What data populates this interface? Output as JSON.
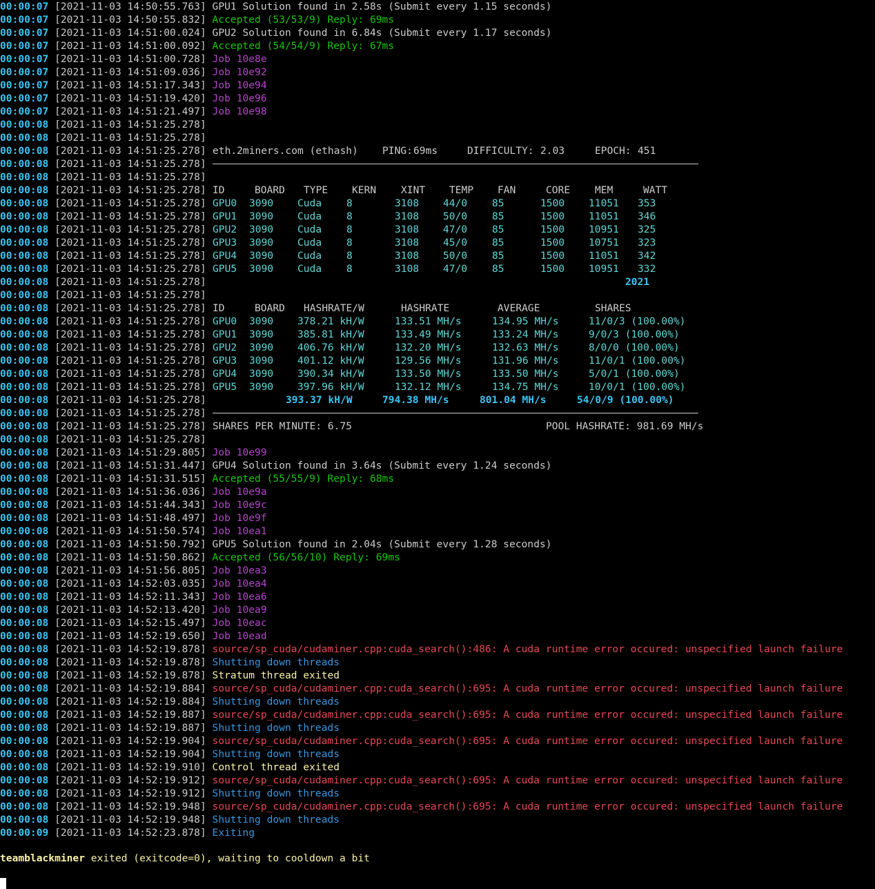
{
  "colors": {
    "background": "#000000",
    "time": "#3bc4f2",
    "default": "#cccccc",
    "accepted": "#16c60c",
    "job": "#b148c6",
    "error": "#e74856",
    "shutdown": "#3a96dd",
    "exited": "#f9f1a5",
    "table_values": "#61d6d6"
  },
  "log_pre": [
    {
      "time": "00:00:07",
      "ts": "[2021-11-03 14:50:55.763]",
      "msg": "GPU1 Solution found in 2.58s (Submit every 1.15 seconds)",
      "color": "white"
    },
    {
      "time": "00:00:07",
      "ts": "[2021-11-03 14:50:55.832]",
      "msg": "Accepted (53/53/9) Reply: 69ms",
      "color": "green"
    },
    {
      "time": "00:00:07",
      "ts": "[2021-11-03 14:51:00.024]",
      "msg": "GPU2 Solution found in 6.84s (Submit every 1.17 seconds)",
      "color": "white"
    },
    {
      "time": "00:00:07",
      "ts": "[2021-11-03 14:51:00.092]",
      "msg": "Accepted (54/54/9) Reply: 67ms",
      "color": "green"
    },
    {
      "time": "00:00:07",
      "ts": "[2021-11-03 14:51:00.728]",
      "msg": "Job 10e8e",
      "color": "magenta"
    },
    {
      "time": "00:00:07",
      "ts": "[2021-11-03 14:51:09.036]",
      "msg": "Job 10e92",
      "color": "magenta"
    },
    {
      "time": "00:00:07",
      "ts": "[2021-11-03 14:51:17.343]",
      "msg": "Job 10e94",
      "color": "magenta"
    },
    {
      "time": "00:00:07",
      "ts": "[2021-11-03 14:51:19.420]",
      "msg": "Job 10e96",
      "color": "magenta"
    },
    {
      "time": "00:00:07",
      "ts": "[2021-11-03 14:51:21.497]",
      "msg": "Job 10e98",
      "color": "magenta"
    },
    {
      "time": "00:00:08",
      "ts": "[2021-11-03 14:51:25.278]",
      "msg": "",
      "color": "white"
    },
    {
      "time": "00:00:08",
      "ts": "[2021-11-03 14:51:25.278]",
      "msg": "",
      "color": "white"
    }
  ],
  "pool": {
    "time": "00:00:08",
    "ts": "[2021-11-03 14:51:25.278]",
    "name": "eth.2miners.com (ethash)",
    "ping_label": "PING:",
    "ping": "69ms",
    "difficulty_label": "DIFFICULTY:",
    "difficulty": "2.03",
    "epoch_label": "EPOCH:",
    "epoch": "451"
  },
  "gap1": [
    {
      "time": "00:00:08",
      "ts": "[2021-11-03 14:51:25.278]"
    },
    {
      "time": "00:00:08",
      "ts": "[2021-11-03 14:51:25.278]"
    }
  ],
  "table1": {
    "time": "00:00:08",
    "ts": "[2021-11-03 14:51:25.278]",
    "headers": [
      "ID",
      "BOARD",
      "TYPE",
      "KERN",
      "XINT",
      "TEMP",
      "FAN",
      "CORE",
      "MEM",
      "WATT"
    ],
    "rows": [
      [
        "GPU0",
        "3090",
        "Cuda",
        "8",
        "3108",
        "44/0",
        "85",
        "1500",
        "11051",
        "353"
      ],
      [
        "GPU1",
        "3090",
        "Cuda",
        "8",
        "3108",
        "50/0",
        "85",
        "1500",
        "11051",
        "346"
      ],
      [
        "GPU2",
        "3090",
        "Cuda",
        "8",
        "3108",
        "47/0",
        "85",
        "1500",
        "10951",
        "325"
      ],
      [
        "GPU3",
        "3090",
        "Cuda",
        "8",
        "3108",
        "45/0",
        "85",
        "1500",
        "10751",
        "323"
      ],
      [
        "GPU4",
        "3090",
        "Cuda",
        "8",
        "3108",
        "50/0",
        "85",
        "1500",
        "11051",
        "342"
      ],
      [
        "GPU5",
        "3090",
        "Cuda",
        "8",
        "3108",
        "47/0",
        "85",
        "1500",
        "10951",
        "332"
      ]
    ],
    "total_watt": "2021"
  },
  "gap2": [
    {
      "time": "00:00:08",
      "ts": "[2021-11-03 14:51:25.278]"
    }
  ],
  "table2": {
    "time": "00:00:08",
    "ts": "[2021-11-03 14:51:25.278]",
    "headers": [
      "ID",
      "BOARD",
      "HASHRATE/W",
      "HASHRATE",
      "AVERAGE",
      "SHARES"
    ],
    "rows": [
      [
        "GPU0",
        "3090",
        "378.21 kH/W",
        "133.51 MH/s",
        "134.95 MH/s",
        "11/0/3 (100.00%)"
      ],
      [
        "GPU1",
        "3090",
        "385.81 kH/W",
        "133.49 MH/s",
        "133.24 MH/s",
        "9/0/3 (100.00%)"
      ],
      [
        "GPU2",
        "3090",
        "406.76 kH/W",
        "132.20 MH/s",
        "132.63 MH/s",
        "8/0/0 (100.00%)"
      ],
      [
        "GPU3",
        "3090",
        "401.12 kH/W",
        "129.56 MH/s",
        "131.96 MH/s",
        "11/0/1 (100.00%)"
      ],
      [
        "GPU4",
        "3090",
        "390.34 kH/W",
        "133.50 MH/s",
        "133.50 MH/s",
        "5/0/1 (100.00%)"
      ],
      [
        "GPU5",
        "3090",
        "397.96 kH/W",
        "132.12 MH/s",
        "134.75 MH/s",
        "10/0/1 (100.00%)"
      ]
    ],
    "totals": [
      "393.37 kH/W",
      "794.38 MH/s",
      "801.04 MH/s",
      "54/0/9 (100.00%)"
    ]
  },
  "gap3": [
    {
      "time": "00:00:08",
      "ts": "[2021-11-03 14:51:25.278]"
    }
  ],
  "summary": {
    "time": "00:00:08",
    "ts": "[2021-11-03 14:51:25.278]",
    "shares_per_minute": "SHARES PER MINUTE: 6.75",
    "pool_hashrate": "POOL HASHRATE: 981.69 MH/s"
  },
  "log_post": [
    {
      "time": "00:00:08",
      "ts": "[2021-11-03 14:51:25.278]",
      "msg": "",
      "color": "white"
    },
    {
      "time": "00:00:08",
      "ts": "[2021-11-03 14:51:29.805]",
      "msg": "Job 10e99",
      "color": "magenta"
    },
    {
      "time": "00:00:08",
      "ts": "[2021-11-03 14:51:31.447]",
      "msg": "GPU4 Solution found in 3.64s (Submit every 1.24 seconds)",
      "color": "white"
    },
    {
      "time": "00:00:08",
      "ts": "[2021-11-03 14:51:31.515]",
      "msg": "Accepted (55/55/9) Reply: 68ms",
      "color": "green"
    },
    {
      "time": "00:00:08",
      "ts": "[2021-11-03 14:51:36.036]",
      "msg": "Job 10e9a",
      "color": "magenta"
    },
    {
      "time": "00:00:08",
      "ts": "[2021-11-03 14:51:44.343]",
      "msg": "Job 10e9c",
      "color": "magenta"
    },
    {
      "time": "00:00:08",
      "ts": "[2021-11-03 14:51:48.497]",
      "msg": "Job 10e9f",
      "color": "magenta"
    },
    {
      "time": "00:00:08",
      "ts": "[2021-11-03 14:51:50.574]",
      "msg": "Job 10ea1",
      "color": "magenta"
    },
    {
      "time": "00:00:08",
      "ts": "[2021-11-03 14:51:50.792]",
      "msg": "GPU5 Solution found in 2.04s (Submit every 1.28 seconds)",
      "color": "white"
    },
    {
      "time": "00:00:08",
      "ts": "[2021-11-03 14:51:50.862]",
      "msg": "Accepted (56/56/10) Reply: 69ms",
      "color": "green"
    },
    {
      "time": "00:00:08",
      "ts": "[2021-11-03 14:51:56.805]",
      "msg": "Job 10ea3",
      "color": "magenta"
    },
    {
      "time": "00:00:08",
      "ts": "[2021-11-03 14:52:03.035]",
      "msg": "Job 10ea4",
      "color": "magenta"
    },
    {
      "time": "00:00:08",
      "ts": "[2021-11-03 14:52:11.343]",
      "msg": "Job 10ea6",
      "color": "magenta"
    },
    {
      "time": "00:00:08",
      "ts": "[2021-11-03 14:52:13.420]",
      "msg": "Job 10ea9",
      "color": "magenta"
    },
    {
      "time": "00:00:08",
      "ts": "[2021-11-03 14:52:15.497]",
      "msg": "Job 10eac",
      "color": "magenta"
    },
    {
      "time": "00:00:08",
      "ts": "[2021-11-03 14:52:19.650]",
      "msg": "Job 10ead",
      "color": "magenta"
    },
    {
      "time": "00:00:08",
      "ts": "[2021-11-03 14:52:19.878]",
      "msg": "source/sp_cuda/cudaminer.cpp:cuda_search():486: A cuda runtime error occured: unspecified launch failure",
      "color": "red"
    },
    {
      "time": "00:00:08",
      "ts": "[2021-11-03 14:52:19.878]",
      "msg": "Shutting down threads",
      "color": "cyan"
    },
    {
      "time": "00:00:08",
      "ts": "[2021-11-03 14:52:19.878]",
      "msg": "Stratum thread exited",
      "color": "yellow"
    },
    {
      "time": "00:00:08",
      "ts": "[2021-11-03 14:52:19.884]",
      "msg": "source/sp_cuda/cudaminer.cpp:cuda_search():695: A cuda runtime error occured: unspecified launch failure",
      "color": "red"
    },
    {
      "time": "00:00:08",
      "ts": "[2021-11-03 14:52:19.884]",
      "msg": "Shutting down threads",
      "color": "cyan"
    },
    {
      "time": "00:00:08",
      "ts": "[2021-11-03 14:52:19.887]",
      "msg": "source/sp_cuda/cudaminer.cpp:cuda_search():695: A cuda runtime error occured: unspecified launch failure",
      "color": "red"
    },
    {
      "time": "00:00:08",
      "ts": "[2021-11-03 14:52:19.887]",
      "msg": "Shutting down threads",
      "color": "cyan"
    },
    {
      "time": "00:00:08",
      "ts": "[2021-11-03 14:52:19.904]",
      "msg": "source/sp_cuda/cudaminer.cpp:cuda_search():695: A cuda runtime error occured: unspecified launch failure",
      "color": "red"
    },
    {
      "time": "00:00:08",
      "ts": "[2021-11-03 14:52:19.904]",
      "msg": "Shutting down threads",
      "color": "cyan"
    },
    {
      "time": "00:00:08",
      "ts": "[2021-11-03 14:52:19.910]",
      "msg": "Control thread exited",
      "color": "yellow"
    },
    {
      "time": "00:00:08",
      "ts": "[2021-11-03 14:52:19.912]",
      "msg": "source/sp_cuda/cudaminer.cpp:cuda_search():695: A cuda runtime error occured: unspecified launch failure",
      "color": "red"
    },
    {
      "time": "00:00:08",
      "ts": "[2021-11-03 14:52:19.912]",
      "msg": "Shutting down threads",
      "color": "cyan"
    },
    {
      "time": "00:00:08",
      "ts": "[2021-11-03 14:52:19.948]",
      "msg": "source/sp_cuda/cudaminer.cpp:cuda_search():695: A cuda runtime error occured: unspecified launch failure",
      "color": "red"
    },
    {
      "time": "00:00:08",
      "ts": "[2021-11-03 14:52:19.948]",
      "msg": "Shutting down threads",
      "color": "cyan"
    },
    {
      "time": "00:00:09",
      "ts": "[2021-11-03 14:52:23.878]",
      "msg": "Exiting",
      "color": "cyan"
    }
  ],
  "footer": {
    "program": "teamblackminer",
    "message": " exited (exitcode=0), waiting to cooldown a bit"
  }
}
